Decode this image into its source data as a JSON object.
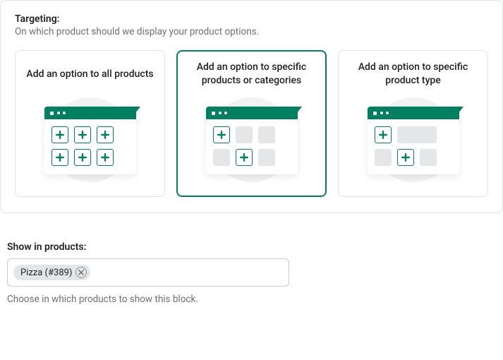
{
  "targeting": {
    "title": "Targeting:",
    "subtitle": "On which product should we display your product options.",
    "selectedIndex": 1,
    "cards": [
      {
        "label": "Add an option to all products"
      },
      {
        "label": "Add an option to specific products or categories"
      },
      {
        "label": "Add an option to specific product type"
      }
    ]
  },
  "showInProducts": {
    "label": "Show in products:",
    "tags": [
      {
        "text": "Pizza (#389)"
      }
    ],
    "helper": "Choose in which products to show this block."
  },
  "colors": {
    "brand": "#008060"
  }
}
